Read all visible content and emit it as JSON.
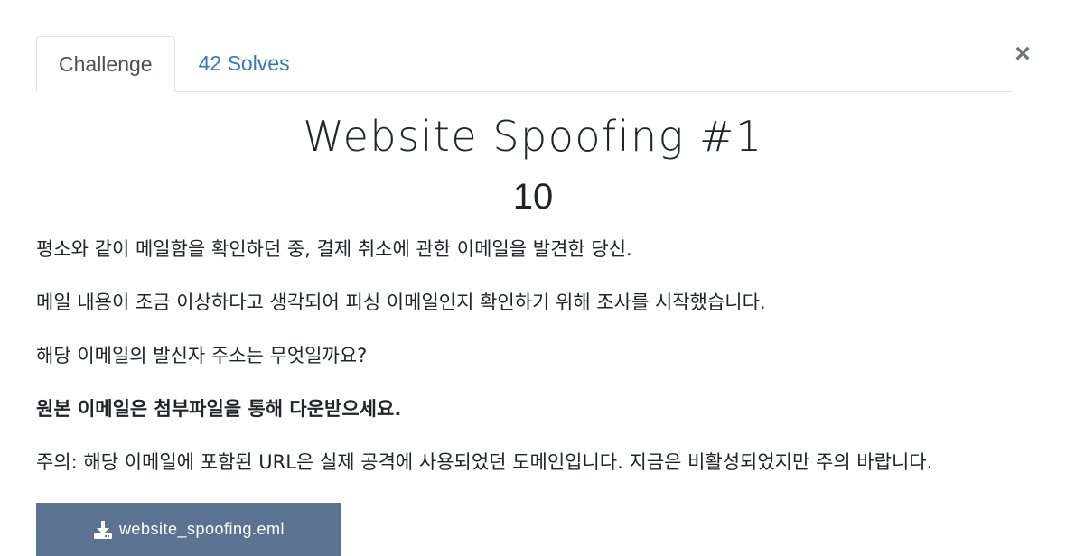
{
  "tabs": [
    {
      "label": "Challenge",
      "active": true
    },
    {
      "label": "42 Solves",
      "active": false
    }
  ],
  "close_label": "×",
  "challenge": {
    "title": "Website Spoofing #1",
    "points": "10"
  },
  "description": [
    "평소와 같이 메일함을 확인하던 중, 결제 취소에 관한 이메일을 발견한 당신.",
    "메일 내용이 조금 이상하다고 생각되어 피싱 이메일인지 확인하기 위해 조사를 시작했습니다.",
    "해당 이메일의 발신자 주소는 무엇일까요?",
    "원본 이메일은 첨부파일을 통해 다운받으세요.",
    "주의: 해당 이메일에 포함된 URL은 실제 공격에 사용되었던 도메인입니다. 지금은 비활성되었지만 주의 바랍니다."
  ],
  "file": {
    "name": "website_spoofing.eml",
    "icon": "download-icon"
  },
  "colors": {
    "link": "#337ab7",
    "button_bg": "#5b7290",
    "text": "#212529"
  }
}
